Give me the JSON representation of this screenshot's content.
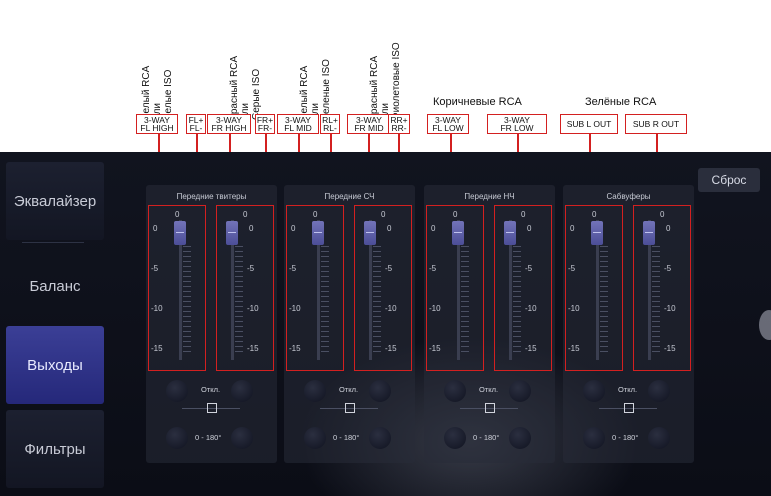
{
  "annotations": {
    "rotated": [
      {
        "lines": [
          "Белый RCA",
          "или",
          "Белые ISO"
        ]
      },
      {
        "lines": [
          "Красный RCA",
          "или",
          "Серые ISO"
        ]
      },
      {
        "lines": [
          "Белый RCA",
          "или",
          "Зеленые ISO"
        ]
      },
      {
        "lines": [
          "Красный RCA",
          "или",
          "Фиолетовые ISO"
        ]
      }
    ],
    "horizontal": [
      "Коричневые RCA",
      "Зелёные RCA"
    ],
    "tags": [
      {
        "l1": "3-WAY",
        "l2": "FL HIGH"
      },
      {
        "l1": "FL+",
        "l2": "FL-"
      },
      {
        "l1": "3-WAY",
        "l2": "FR HIGH"
      },
      {
        "l1": "FR+",
        "l2": "FR-"
      },
      {
        "l1": "3-WAY",
        "l2": "FL MID"
      },
      {
        "l1": "RL+",
        "l2": "RL-"
      },
      {
        "l1": "3-WAY",
        "l2": "FR MID"
      },
      {
        "l1": "RR+",
        "l2": "RR-"
      },
      {
        "l1": "3-WAY",
        "l2": "FL LOW"
      },
      {
        "l1": "3-WAY",
        "l2": "FR LOW"
      },
      {
        "l1": "SUB L OUT",
        "l2": ""
      },
      {
        "l1": "SUB R OUT",
        "l2": ""
      }
    ],
    "accent_color": "#d32020"
  },
  "sidebar": {
    "items": [
      {
        "label": "Эквалайзер"
      },
      {
        "label": "Баланс"
      },
      {
        "label": "Выходы"
      },
      {
        "label": "Фильтры"
      }
    ]
  },
  "header": {
    "reset_label": "Сброс"
  },
  "panels": [
    {
      "title": "Передние твитеры",
      "phase_label": "Откл.",
      "phase_value": "0",
      "angle_label": "0 - 180°"
    },
    {
      "title": "Передние СЧ",
      "phase_label": "Откл.",
      "phase_value": "0",
      "angle_label": "0 - 180°"
    },
    {
      "title": "Передние НЧ",
      "phase_label": "Откл.",
      "phase_value": "0",
      "angle_label": "0 - 180°"
    },
    {
      "title": "Сабвуферы",
      "phase_label": "Откл.",
      "phase_value": "0",
      "angle_label": "0 - 180°"
    }
  ],
  "scale": {
    "top": "0",
    "left": [
      "0",
      "-5",
      "-10",
      "-15"
    ]
  },
  "colors": {
    "active_tab": "#2f3288",
    "knob": "#5e60a8",
    "background": "#0c0f1a"
  }
}
